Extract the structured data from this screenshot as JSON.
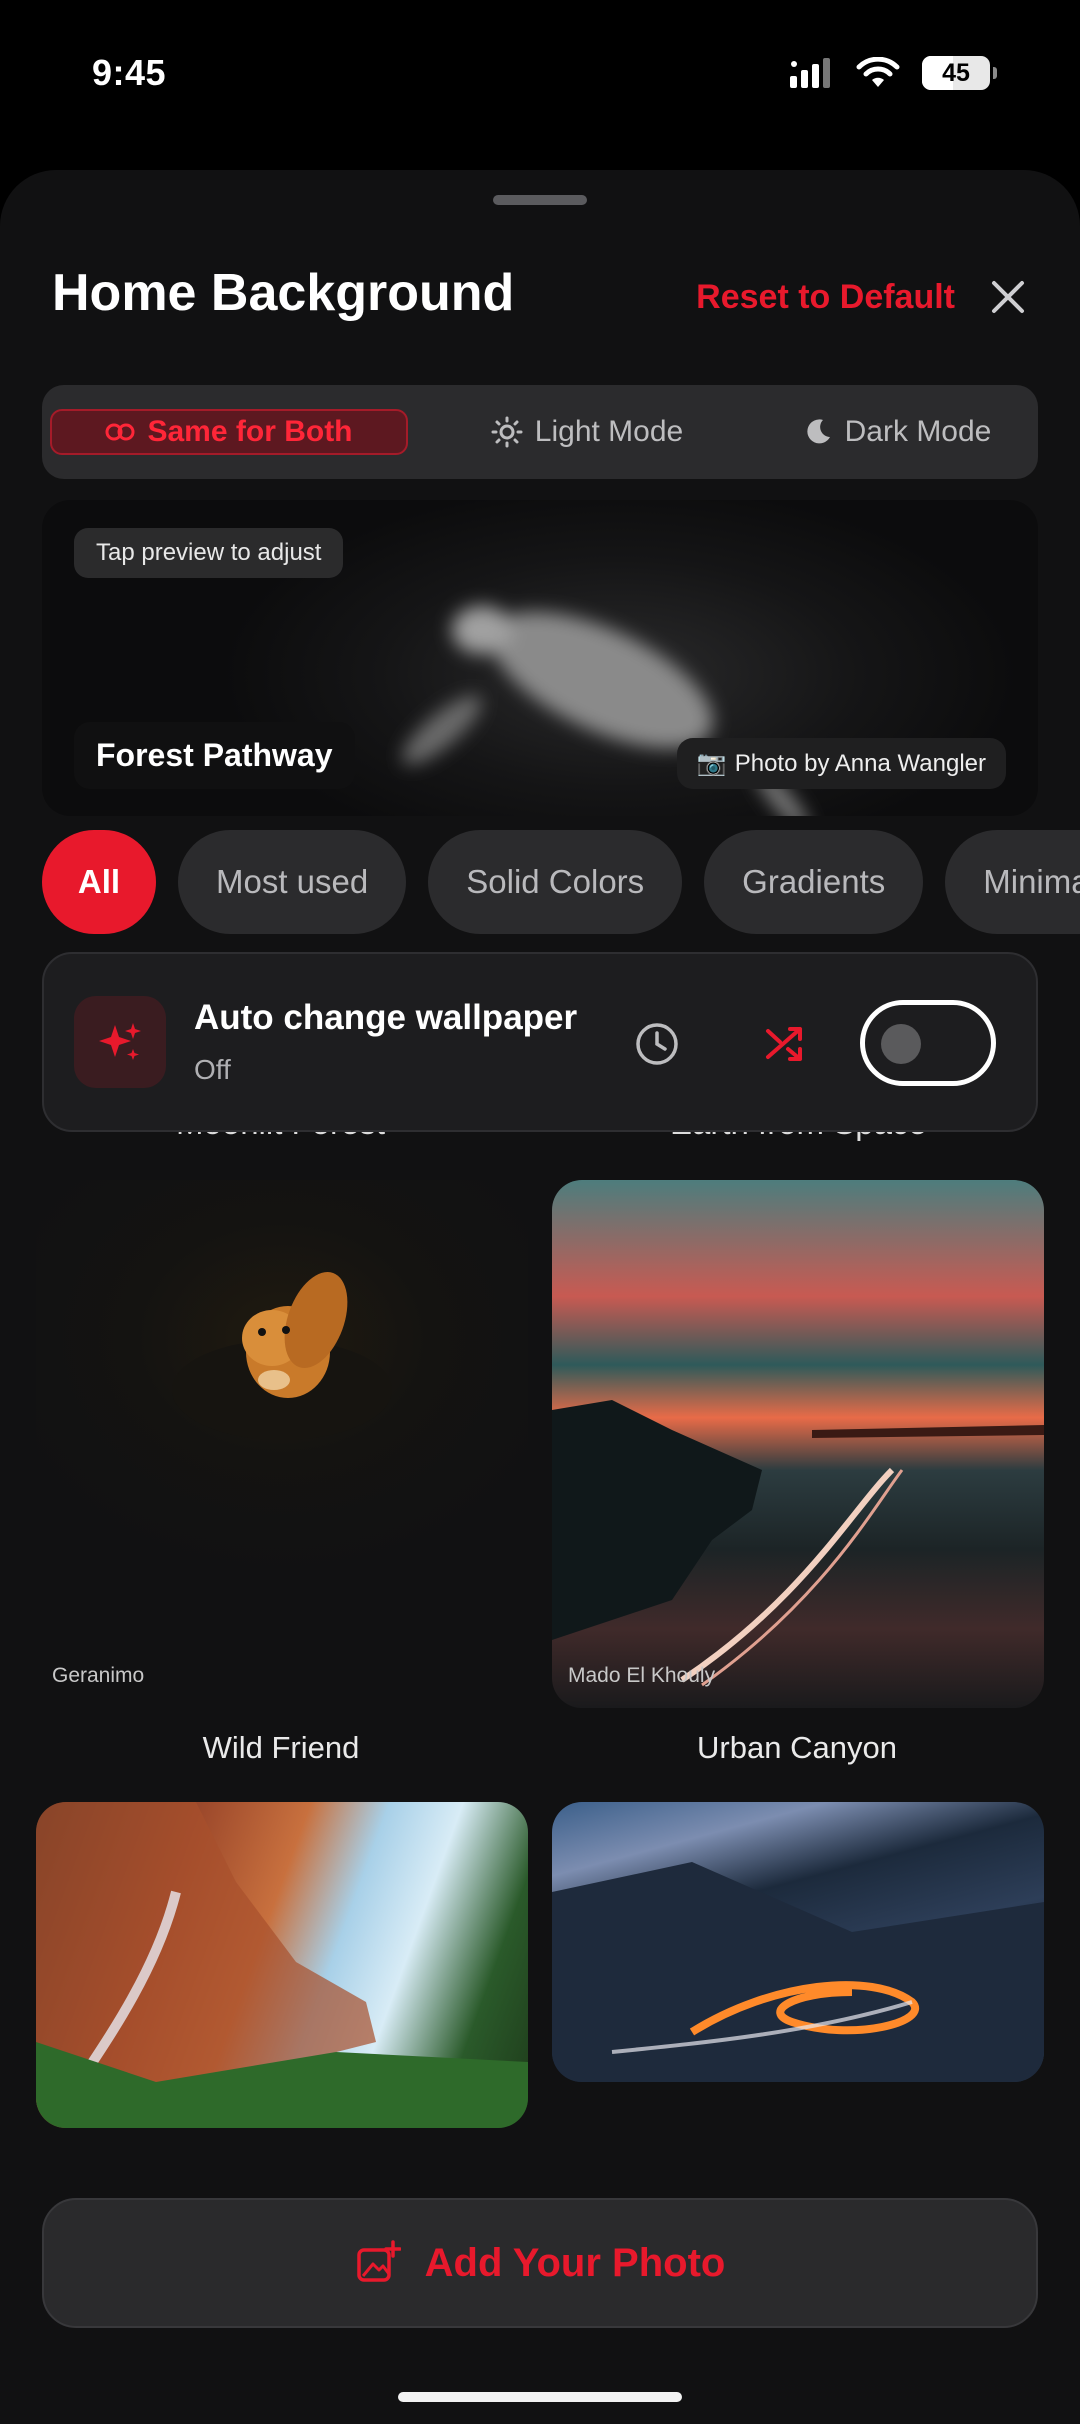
{
  "status_bar": {
    "time": "9:45",
    "battery": "45",
    "battery_level": 0.45
  },
  "header": {
    "title": "Home Background",
    "reset_label": "Reset to Default"
  },
  "mode_tabs": [
    {
      "label": "Same for Both",
      "icon": "link-icon",
      "selected": true
    },
    {
      "label": "Light Mode",
      "icon": "sun-icon",
      "selected": false
    },
    {
      "label": "Dark Mode",
      "icon": "moon-icon",
      "selected": false
    }
  ],
  "preview": {
    "hint": "Tap preview to adjust",
    "name": "Forest Pathway",
    "credit": "Photo by Anna Wangler",
    "credit_icon": "camera-icon"
  },
  "categories": [
    {
      "label": "All",
      "selected": true
    },
    {
      "label": "Most used",
      "selected": false
    },
    {
      "label": "Solid Colors",
      "selected": false
    },
    {
      "label": "Gradients",
      "selected": false
    },
    {
      "label": "Minimal",
      "selected": false
    }
  ],
  "auto_change": {
    "title": "Auto change wallpaper",
    "status": "Off",
    "enabled": false
  },
  "wallpapers": [
    {
      "title": "Moonlit Forest",
      "credit": ""
    },
    {
      "title": "Earth from Space",
      "credit": ""
    },
    {
      "title": "Wild Friend",
      "credit": "Geranimo"
    },
    {
      "title": "Urban Canyon",
      "credit": "Mado El Khouly"
    }
  ],
  "add_photo": {
    "label": "Add Your Photo"
  },
  "colors": {
    "accent": "#e8192c",
    "background": "#111112",
    "surface": "#2b2b2d"
  }
}
